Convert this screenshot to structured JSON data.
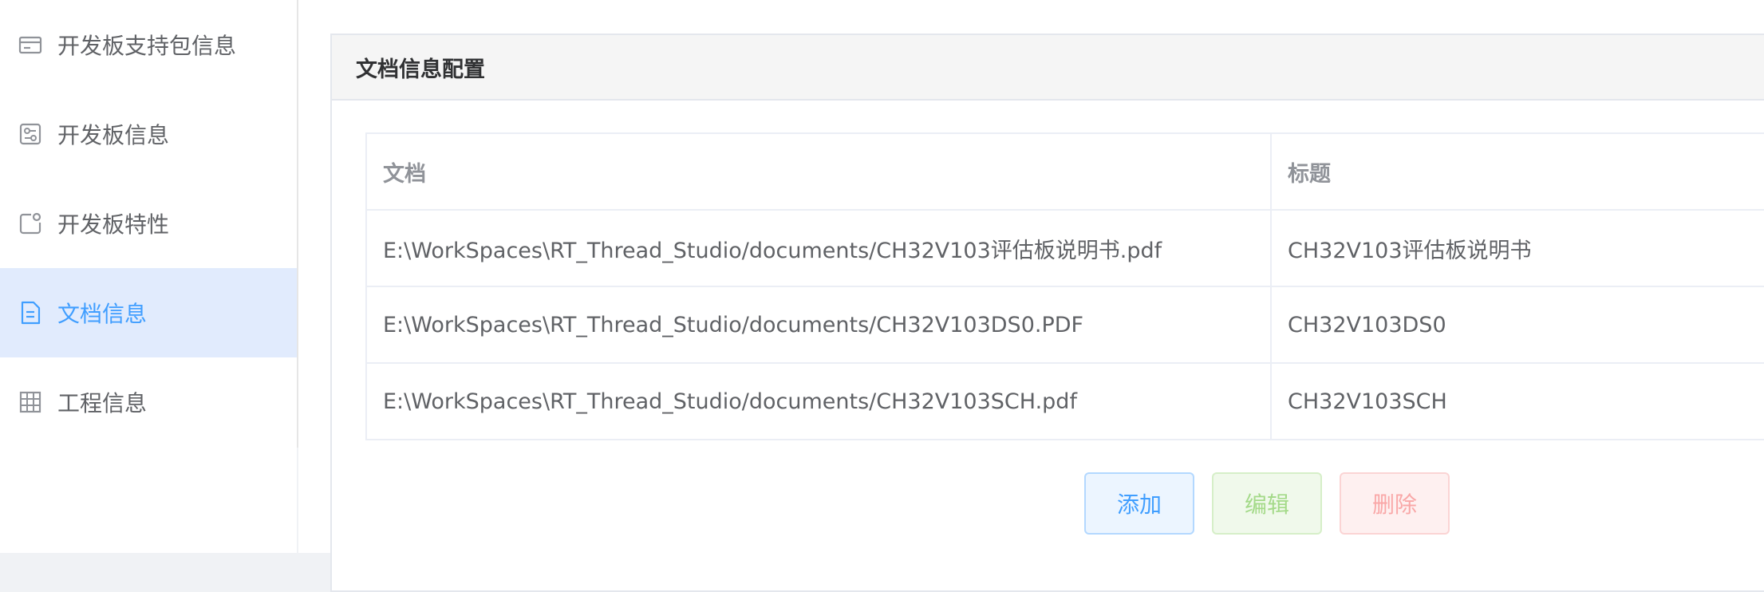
{
  "sidebar": {
    "items": [
      {
        "label": "开发板支持包信息",
        "icon": "card-icon"
      },
      {
        "label": "开发板信息",
        "icon": "board-settings-icon"
      },
      {
        "label": "开发板特性",
        "icon": "feature-icon"
      },
      {
        "label": "文档信息",
        "icon": "document-icon",
        "active": true
      },
      {
        "label": "工程信息",
        "icon": "grid-icon"
      }
    ]
  },
  "card": {
    "title": "文档信息配置"
  },
  "table": {
    "headers": [
      "文档",
      "标题"
    ],
    "rows": [
      [
        "E:\\WorkSpaces\\RT_Thread_Studio/documents/CH32V103评估板说明书.pdf",
        "CH32V103评估板说明书"
      ],
      [
        "E:\\WorkSpaces\\RT_Thread_Studio/documents/CH32V103DS0.PDF",
        "CH32V103DS0"
      ],
      [
        "E:\\WorkSpaces\\RT_Thread_Studio/documents/CH32V103SCH.pdf",
        "CH32V103SCH"
      ]
    ]
  },
  "buttons": {
    "add": "添加",
    "edit": "编辑",
    "delete": "删除"
  },
  "colors": {
    "accent": "#409eff",
    "active_bg": "#e1ebfd"
  }
}
